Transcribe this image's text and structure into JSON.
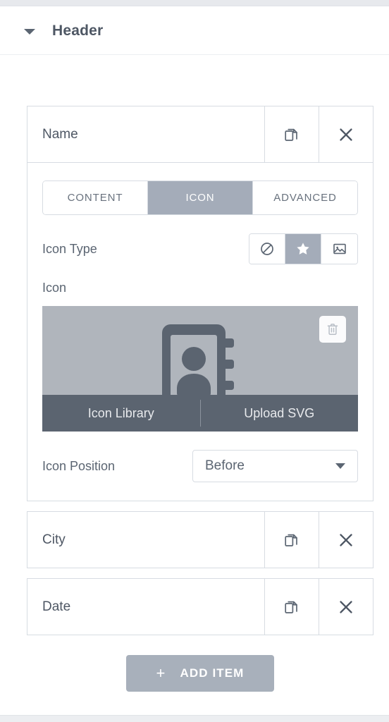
{
  "section": {
    "title": "Header",
    "collapse_icon": "caret-down-icon",
    "expanded": true
  },
  "repeater": {
    "items": [
      {
        "title": "Name",
        "duplicate_icon": "copy-icon",
        "remove_icon": "close-icon",
        "expanded": true
      },
      {
        "title": "City",
        "duplicate_icon": "copy-icon",
        "remove_icon": "close-icon",
        "expanded": false
      },
      {
        "title": "Date",
        "duplicate_icon": "copy-icon",
        "remove_icon": "close-icon",
        "expanded": false
      }
    ],
    "add_item": {
      "label": "ADD ITEM",
      "plus": "+"
    }
  },
  "panel": {
    "tabs": [
      {
        "label": "CONTENT",
        "active": false
      },
      {
        "label": "ICON",
        "active": true
      },
      {
        "label": "ADVANCED",
        "active": false
      }
    ],
    "icon_type": {
      "label": "Icon Type",
      "options": [
        {
          "name": "none-icon",
          "active": false
        },
        {
          "name": "star-icon",
          "active": true
        },
        {
          "name": "image-icon",
          "active": false
        }
      ]
    },
    "icon": {
      "label": "Icon",
      "preview_glyph": "address-book-icon",
      "delete_icon": "trash-icon",
      "library_label": "Icon Library",
      "upload_label": "Upload SVG"
    },
    "icon_position": {
      "label": "Icon Position",
      "value": "Before",
      "caret": "caret-down-icon"
    }
  },
  "colors": {
    "accent_active": "#a4acb9",
    "text": "#4e5764",
    "muted_text": "#5b6572",
    "border": "#d7dce2",
    "preview_bg": "#b0b5bc",
    "preview_bar": "#5b6470",
    "add_button": "#a8b0bb"
  }
}
